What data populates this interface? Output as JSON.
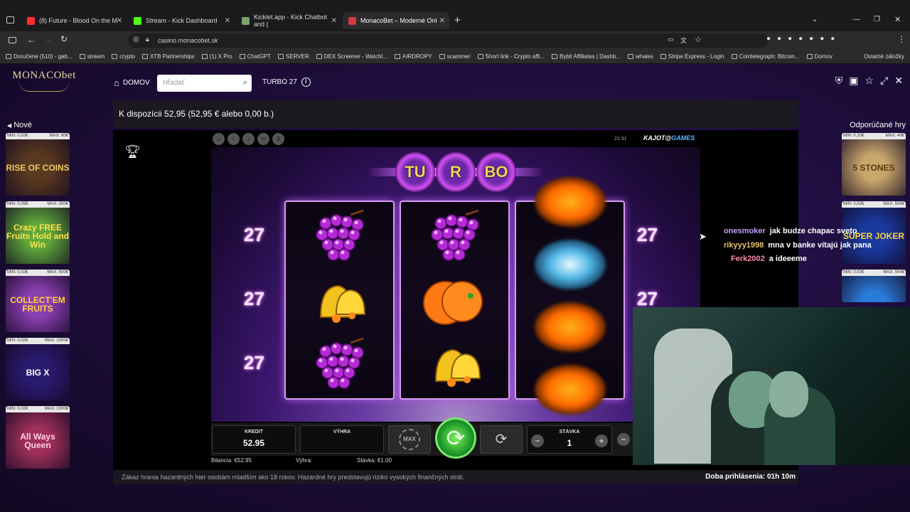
{
  "browser": {
    "tabs": [
      {
        "title": "(8) Future - Blood On the M",
        "color": "#ff2d2d"
      },
      {
        "title": "Stream - Kick Dashboard",
        "color": "#53fc18"
      },
      {
        "title": "Kicklet.app - Kick Chatbot and (",
        "color": "#7aa26a"
      },
      {
        "title": "MonacoBet – Moderné Onl",
        "color": "#d63a3a"
      }
    ],
    "url": "casino.monacobet.sk",
    "bookmarks": [
      "Doručené (510) - gab...",
      "stream",
      "crypto",
      "XTB Partnerships",
      "(1) X Pro",
      "ChatGPT",
      "SERVER",
      "DEX Screener - Watchl...",
      "AIRDROPY",
      "scammer",
      "Short link - Crypto affi...",
      "Bybit Affiliates | Dashb...",
      "whales",
      "Stripe Express - Login",
      "Cointelegraph: Bitcoin...",
      "Domov"
    ],
    "other_bookmarks": "Ostatné záložky"
  },
  "site": {
    "logo": "MONACObet",
    "nav_home": "DOMOV",
    "search_placeholder": "Hľadať",
    "turbo_label": "TURBO 27",
    "balance_text": "K dispozícii 52,95 (52,95 € alebo 0,00 b.)",
    "left_heading": "Nové",
    "right_heading": "Odporúčané hry",
    "login_time": "Doba prihlásenia: 01h 10m",
    "disclaimer": "Zákaz hrania hazardných hier osobám mladším ako 18 rokov. Hazardné hry predstavujú riziko vysokých finančných strát."
  },
  "new_games": [
    {
      "min": "MIN: 0,02€",
      "max": "MAX: 60€",
      "name": "RISE OF COINS",
      "bg": "#5a3a1f",
      "fg": "#f0c860"
    },
    {
      "min": "MIN: 0,05€",
      "max": "MAX: 300€",
      "name": "Crazy FREE Fruits Hold and Win",
      "bg": "#5fa83a",
      "fg": "#ffe14a"
    },
    {
      "min": "MIN: 0,02€",
      "max": "MAX: 500€",
      "name": "COLLECT'EM FRUITS",
      "bg": "#8a3fb0",
      "fg": "#ffd23a"
    },
    {
      "min": "MIN: 0,02€",
      "max": "MAX: 1000€",
      "name": "BIG X",
      "bg": "#2a1a6e",
      "fg": "#ffffff"
    },
    {
      "min": "MIN: 0,02€",
      "max": "MAX: 1000€",
      "name": "All Ways Queen",
      "bg": "#a0305a",
      "fg": "#ffd0e8"
    }
  ],
  "recommended_games": [
    {
      "min": "MIN: 0,10€",
      "max": "MAX: 40€",
      "name": "5 STONES",
      "bg": "#c9a66b",
      "fg": "#5a3a12"
    },
    {
      "min": "MIN: 0,02€",
      "max": "MAX: 500€",
      "name": "SUPER JOKER",
      "bg": "#1a3aa0",
      "fg": "#ffd23a"
    },
    {
      "min": "MIN: 0,02€",
      "max": "MAX: 500€",
      "name": "",
      "bg": "#2a7ad8",
      "fg": "#ffffff"
    }
  ],
  "game": {
    "clock": "21:31",
    "provider": "KAJOT",
    "provider_suffix": "GAMES",
    "title_balls": [
      "TU",
      "R",
      "BO"
    ],
    "line_counts": [
      "27",
      "27",
      "27",
      "27",
      "27"
    ],
    "credit_label": "KREDIT",
    "credit_value": "52.95",
    "win_label": "VÝHRA",
    "win_value": "",
    "max_label": "MAX",
    "bet_label": "STÁVKA",
    "bet_value": "1",
    "minus": "−",
    "plus": "+",
    "balance_line": "Bilancia: €52.95",
    "win_line": "Výhra:",
    "bet_line": "Stávka: €1.00",
    "reels": [
      [
        "grapes",
        "bell",
        "grapes"
      ],
      [
        "grapes",
        "orange",
        "bell"
      ],
      [
        "orange-blur",
        "blue-blur",
        "orange-blur",
        "orange-blur"
      ]
    ]
  },
  "chat": [
    {
      "user": "onesmoker",
      "msg": "jak budze chapac sveto"
    },
    {
      "user": "rikyyy1998",
      "msg": "mna v banke vítajú jak pana"
    },
    {
      "user": "Ferk2002",
      "msg": "a ideeeme"
    }
  ]
}
